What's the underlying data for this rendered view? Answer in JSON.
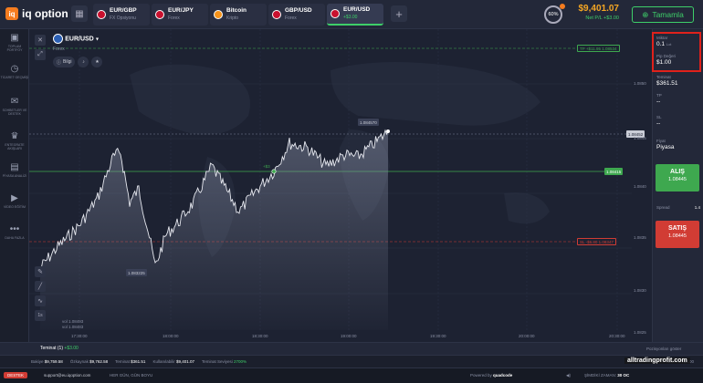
{
  "header": {
    "logo_badge": "iq",
    "logo_text": "iq option",
    "tabs": [
      {
        "name": "EUR/GBP",
        "sub": "FX Opsiyonu"
      },
      {
        "name": "EUR/JPY",
        "sub": "Forex"
      },
      {
        "name": "Bitcoin",
        "sub": "Kripto"
      },
      {
        "name": "GBP/USD",
        "sub": "Forex"
      },
      {
        "name": "EUR/USD",
        "sub": "+$3.00"
      }
    ],
    "level": "60%",
    "balance": "$9,401.07",
    "net_pl": "Net P/L +$3.00",
    "deposit": "Tamamla"
  },
  "sidebar": {
    "items": [
      "TOPLAM PORTFÖY",
      "TİCARET GEÇMİŞİ",
      "SOHBETLER VE DESTEK",
      "ENTEGRATE AKIŞLARI",
      "PİYASA ANALİZİ",
      "VİDEO EĞİTİM",
      "DAHA FAZLA"
    ]
  },
  "chart": {
    "pair": "EUR/USD",
    "pair_type": "Forex",
    "info_label": "Bilgi",
    "tp_tag": "TP +$11.95 1.08534",
    "sl_tag": "SL -$6.80 1.08347",
    "current_price": "1.08452",
    "open_price": "1.08415",
    "high_label": "1.084570",
    "low_label": "1.083225",
    "profit_marker": "+$3",
    "y_ticks": [
      "1.0850",
      "1.0845",
      "1.0840",
      "1.0835",
      "1.0830",
      "1.0825"
    ],
    "x_ticks": [
      "17:30:00",
      "18:00:00",
      "18:30:00",
      "19:00:00",
      "19:30:00",
      "20:00:00",
      "20:30:00"
    ],
    "zoom": "1s",
    "vol_labels": [
      "vol 1.08493",
      "vol 1.08483"
    ]
  },
  "panel": {
    "amount_label": "Miktar",
    "amount_value": "0.1",
    "amount_unit": "Lot",
    "pip_label": "Pip Değeri",
    "pip_value": "$1.00",
    "margin_label": "Teminat",
    "margin_value": "$361.51",
    "tp_label": "TP",
    "tp_value": "--",
    "sl_label": "SL",
    "sl_value": "--",
    "price_label": "Fiyat",
    "price_value": "Piyasa",
    "buy_label": "ALIŞ",
    "buy_value": "1.08445",
    "spread_label": "Spread",
    "spread_value": "1.4",
    "sell_label": "SATIŞ",
    "sell_value": "1.08445"
  },
  "bottom": {
    "positions_tab": "Teminat (1)",
    "positions_pl": "+$3.00",
    "show_positions": "Pozisyonları göster",
    "stats": [
      {
        "label": "Bakiye",
        "value": "$9,759.58"
      },
      {
        "label": "Özkaynak",
        "value": "$9,762.58"
      },
      {
        "label": "Teminat",
        "value": "$361.51"
      },
      {
        "label": "Kullanılabilir",
        "value": "$9,401.07"
      },
      {
        "label": "Teminat Seviyesi",
        "value": "2700%"
      }
    ],
    "net_pl": "Net P/L +$3.00",
    "support_badge": "DESTEK",
    "support_email": "support@eu.iqoption.com",
    "tagline": "HER GÜN, GÜN BOYU",
    "powered": "Powered by",
    "provider": "quadcode",
    "time_label": "ŞİMDİKİ ZAMAN:",
    "time_value": "30 OC",
    "watermark": "alltradingprofit.com"
  },
  "colors": {
    "green": "#3ea84f",
    "red": "#d13c34",
    "orange": "#f57c1f",
    "gold": "#f5a623"
  }
}
